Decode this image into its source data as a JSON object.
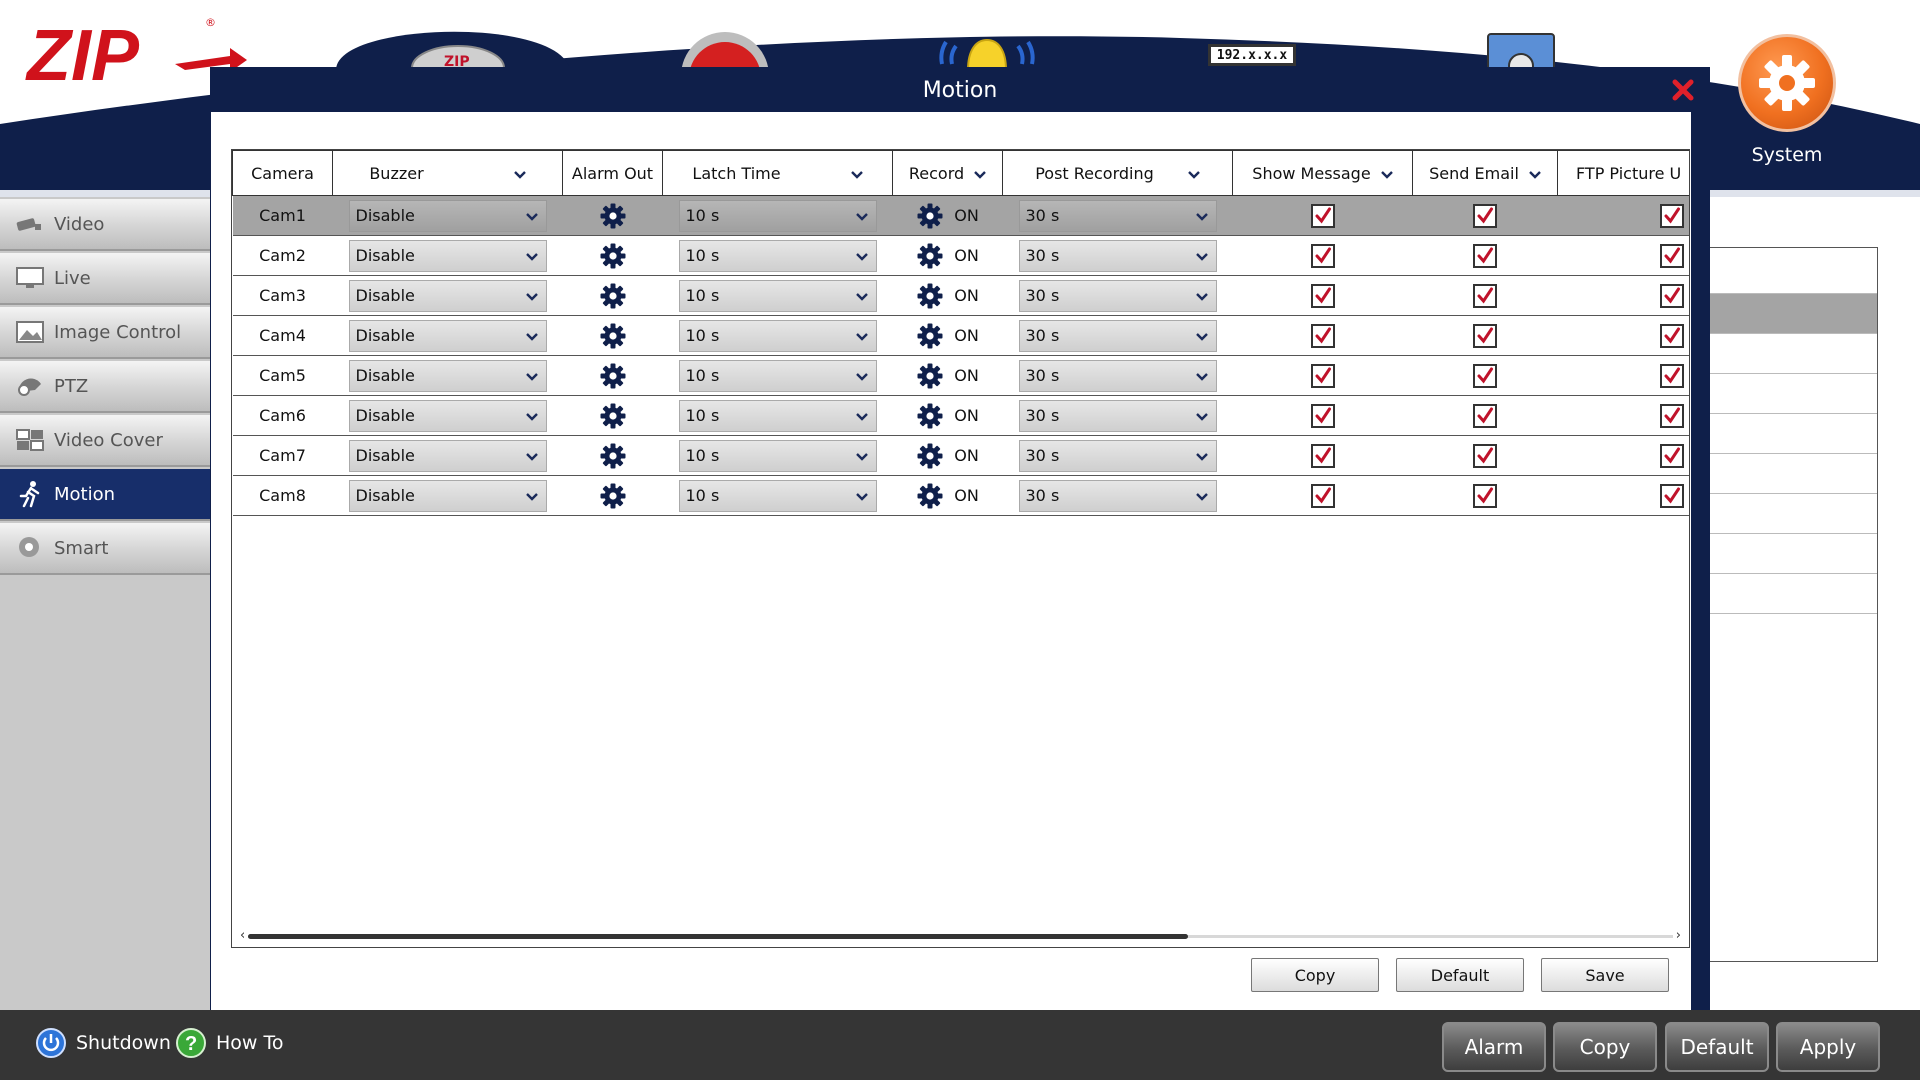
{
  "app": {
    "logo_text": "ZIP",
    "system_label": "System",
    "ip_label": "192.x.x.x"
  },
  "sidebar": {
    "items": [
      {
        "label": "Video",
        "icon": "camera-icon",
        "active": false
      },
      {
        "label": "Live",
        "icon": "monitor-icon",
        "active": false
      },
      {
        "label": "Image Control",
        "icon": "image-icon",
        "active": false
      },
      {
        "label": "PTZ",
        "icon": "ptz-camera-icon",
        "active": false
      },
      {
        "label": "Video Cover",
        "icon": "video-cover-icon",
        "active": false
      },
      {
        "label": "Motion",
        "icon": "running-person-icon",
        "active": true
      },
      {
        "label": "Smart",
        "icon": "smart-head-icon",
        "active": false
      }
    ]
  },
  "modal": {
    "title": "Motion",
    "columns": [
      "Camera",
      "Buzzer",
      "Alarm Out",
      "Latch Time",
      "Record",
      "Post Recording",
      "Show Message",
      "Send Email",
      "FTP Picture U"
    ],
    "rows": [
      {
        "camera": "Cam1",
        "buzzer": "Disable",
        "latch": "10 s",
        "record": "ON",
        "post": "30 s",
        "show_message": true,
        "send_email": true,
        "ftp": true
      },
      {
        "camera": "Cam2",
        "buzzer": "Disable",
        "latch": "10 s",
        "record": "ON",
        "post": "30 s",
        "show_message": true,
        "send_email": true,
        "ftp": true
      },
      {
        "camera": "Cam3",
        "buzzer": "Disable",
        "latch": "10 s",
        "record": "ON",
        "post": "30 s",
        "show_message": true,
        "send_email": true,
        "ftp": true
      },
      {
        "camera": "Cam4",
        "buzzer": "Disable",
        "latch": "10 s",
        "record": "ON",
        "post": "30 s",
        "show_message": true,
        "send_email": true,
        "ftp": true
      },
      {
        "camera": "Cam5",
        "buzzer": "Disable",
        "latch": "10 s",
        "record": "ON",
        "post": "30 s",
        "show_message": true,
        "send_email": true,
        "ftp": true
      },
      {
        "camera": "Cam6",
        "buzzer": "Disable",
        "latch": "10 s",
        "record": "ON",
        "post": "30 s",
        "show_message": true,
        "send_email": true,
        "ftp": true
      },
      {
        "camera": "Cam7",
        "buzzer": "Disable",
        "latch": "10 s",
        "record": "ON",
        "post": "30 s",
        "show_message": true,
        "send_email": true,
        "ftp": true
      },
      {
        "camera": "Cam8",
        "buzzer": "Disable",
        "latch": "10 s",
        "record": "ON",
        "post": "30 s",
        "show_message": true,
        "send_email": true,
        "ftp": true
      }
    ],
    "buttons": {
      "copy": "Copy",
      "default": "Default",
      "save": "Save"
    }
  },
  "footer": {
    "shutdown": "Shutdown",
    "how_to": "How To",
    "buttons": {
      "alarm": "Alarm",
      "copy": "Copy",
      "default": "Default",
      "apply": "Apply"
    }
  },
  "colors": {
    "navy": "#0f1f4a",
    "active_nav": "#172e6a",
    "accent_orange": "#f07020",
    "check_red": "#c0122a",
    "footer": "#353535"
  }
}
